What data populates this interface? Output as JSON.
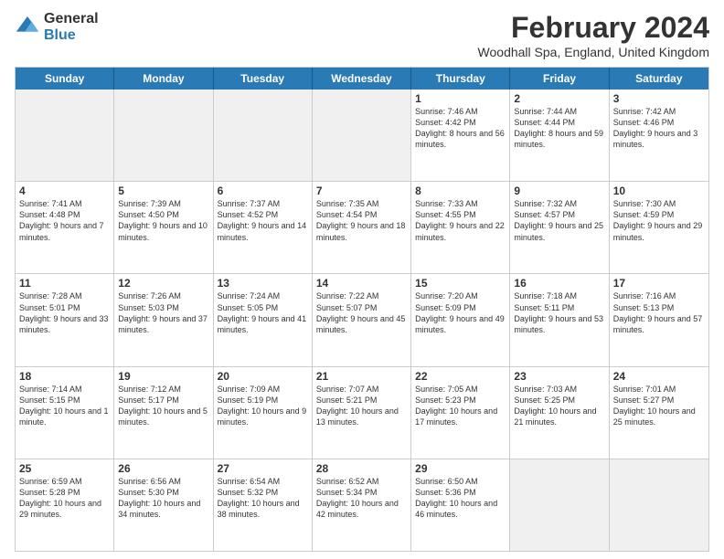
{
  "logo": {
    "general": "General",
    "blue": "Blue"
  },
  "title": "February 2024",
  "subtitle": "Woodhall Spa, England, United Kingdom",
  "header_days": [
    "Sunday",
    "Monday",
    "Tuesday",
    "Wednesday",
    "Thursday",
    "Friday",
    "Saturday"
  ],
  "weeks": [
    [
      {
        "day": "",
        "info": "",
        "shaded": true
      },
      {
        "day": "",
        "info": "",
        "shaded": true
      },
      {
        "day": "",
        "info": "",
        "shaded": true
      },
      {
        "day": "",
        "info": "",
        "shaded": true
      },
      {
        "day": "1",
        "info": "Sunrise: 7:46 AM\nSunset: 4:42 PM\nDaylight: 8 hours and 56 minutes."
      },
      {
        "day": "2",
        "info": "Sunrise: 7:44 AM\nSunset: 4:44 PM\nDaylight: 8 hours and 59 minutes."
      },
      {
        "day": "3",
        "info": "Sunrise: 7:42 AM\nSunset: 4:46 PM\nDaylight: 9 hours and 3 minutes."
      }
    ],
    [
      {
        "day": "4",
        "info": "Sunrise: 7:41 AM\nSunset: 4:48 PM\nDaylight: 9 hours and 7 minutes."
      },
      {
        "day": "5",
        "info": "Sunrise: 7:39 AM\nSunset: 4:50 PM\nDaylight: 9 hours and 10 minutes."
      },
      {
        "day": "6",
        "info": "Sunrise: 7:37 AM\nSunset: 4:52 PM\nDaylight: 9 hours and 14 minutes."
      },
      {
        "day": "7",
        "info": "Sunrise: 7:35 AM\nSunset: 4:54 PM\nDaylight: 9 hours and 18 minutes."
      },
      {
        "day": "8",
        "info": "Sunrise: 7:33 AM\nSunset: 4:55 PM\nDaylight: 9 hours and 22 minutes."
      },
      {
        "day": "9",
        "info": "Sunrise: 7:32 AM\nSunset: 4:57 PM\nDaylight: 9 hours and 25 minutes."
      },
      {
        "day": "10",
        "info": "Sunrise: 7:30 AM\nSunset: 4:59 PM\nDaylight: 9 hours and 29 minutes."
      }
    ],
    [
      {
        "day": "11",
        "info": "Sunrise: 7:28 AM\nSunset: 5:01 PM\nDaylight: 9 hours and 33 minutes."
      },
      {
        "day": "12",
        "info": "Sunrise: 7:26 AM\nSunset: 5:03 PM\nDaylight: 9 hours and 37 minutes."
      },
      {
        "day": "13",
        "info": "Sunrise: 7:24 AM\nSunset: 5:05 PM\nDaylight: 9 hours and 41 minutes."
      },
      {
        "day": "14",
        "info": "Sunrise: 7:22 AM\nSunset: 5:07 PM\nDaylight: 9 hours and 45 minutes."
      },
      {
        "day": "15",
        "info": "Sunrise: 7:20 AM\nSunset: 5:09 PM\nDaylight: 9 hours and 49 minutes."
      },
      {
        "day": "16",
        "info": "Sunrise: 7:18 AM\nSunset: 5:11 PM\nDaylight: 9 hours and 53 minutes."
      },
      {
        "day": "17",
        "info": "Sunrise: 7:16 AM\nSunset: 5:13 PM\nDaylight: 9 hours and 57 minutes."
      }
    ],
    [
      {
        "day": "18",
        "info": "Sunrise: 7:14 AM\nSunset: 5:15 PM\nDaylight: 10 hours and 1 minute."
      },
      {
        "day": "19",
        "info": "Sunrise: 7:12 AM\nSunset: 5:17 PM\nDaylight: 10 hours and 5 minutes."
      },
      {
        "day": "20",
        "info": "Sunrise: 7:09 AM\nSunset: 5:19 PM\nDaylight: 10 hours and 9 minutes."
      },
      {
        "day": "21",
        "info": "Sunrise: 7:07 AM\nSunset: 5:21 PM\nDaylight: 10 hours and 13 minutes."
      },
      {
        "day": "22",
        "info": "Sunrise: 7:05 AM\nSunset: 5:23 PM\nDaylight: 10 hours and 17 minutes."
      },
      {
        "day": "23",
        "info": "Sunrise: 7:03 AM\nSunset: 5:25 PM\nDaylight: 10 hours and 21 minutes."
      },
      {
        "day": "24",
        "info": "Sunrise: 7:01 AM\nSunset: 5:27 PM\nDaylight: 10 hours and 25 minutes."
      }
    ],
    [
      {
        "day": "25",
        "info": "Sunrise: 6:59 AM\nSunset: 5:28 PM\nDaylight: 10 hours and 29 minutes."
      },
      {
        "day": "26",
        "info": "Sunrise: 6:56 AM\nSunset: 5:30 PM\nDaylight: 10 hours and 34 minutes."
      },
      {
        "day": "27",
        "info": "Sunrise: 6:54 AM\nSunset: 5:32 PM\nDaylight: 10 hours and 38 minutes."
      },
      {
        "day": "28",
        "info": "Sunrise: 6:52 AM\nSunset: 5:34 PM\nDaylight: 10 hours and 42 minutes."
      },
      {
        "day": "29",
        "info": "Sunrise: 6:50 AM\nSunset: 5:36 PM\nDaylight: 10 hours and 46 minutes."
      },
      {
        "day": "",
        "info": "",
        "shaded": true
      },
      {
        "day": "",
        "info": "",
        "shaded": true
      }
    ]
  ]
}
